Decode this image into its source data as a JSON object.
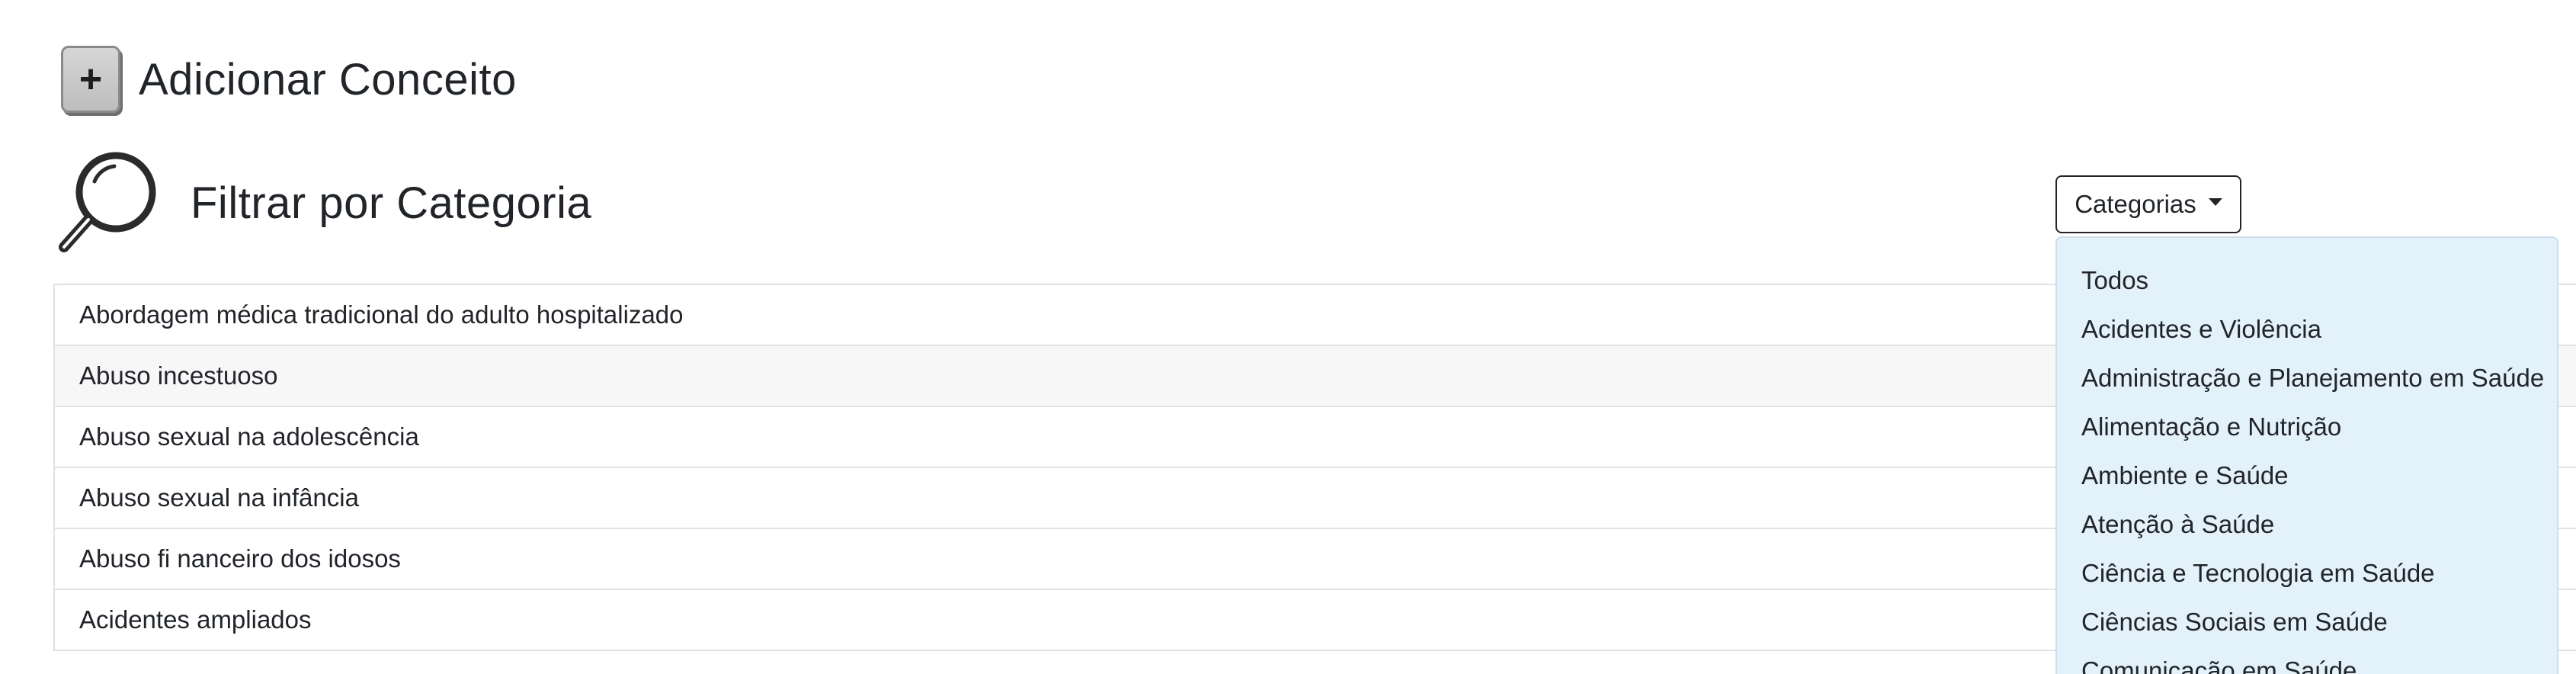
{
  "add_concept": {
    "button_label": "+",
    "title": "Adicionar Conceito"
  },
  "filter": {
    "title": "Filtrar por Categoria",
    "icon": "magnifier-icon"
  },
  "categories_dropdown": {
    "label": "Categorias",
    "items": [
      "Todos",
      "Acidentes e Violência",
      "Administração e Planejamento em Saúde",
      "Alimentação e Nutrição",
      "Ambiente e Saúde",
      "Atenção à Saúde",
      "Ciência e Tecnologia em Saúde",
      "Ciências Sociais em Saúde",
      "Comunicação em Saúde"
    ]
  },
  "concepts": [
    "Abordagem médica tradicional do adulto hospitalizado",
    "Abuso incestuoso",
    "Abuso sexual na adolescência",
    "Abuso sexual na infância",
    "Abuso fi nanceiro dos idosos",
    "Acidentes ampliados"
  ],
  "colors": {
    "menu_background": "#e3f1fb",
    "row_alt": "#f7f7f8",
    "border": "#dee2e6"
  }
}
